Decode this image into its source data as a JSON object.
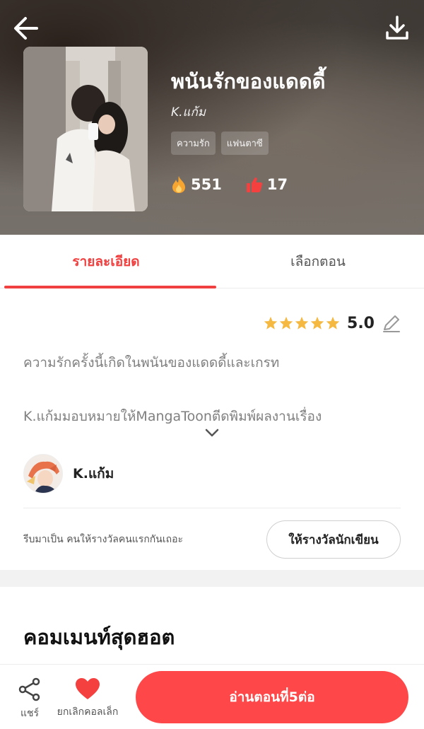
{
  "header": {
    "title": "พนันรักของแดดดี้",
    "author": "K.แก้ม",
    "tags": [
      "ความรัก",
      "แฟนตาซี"
    ],
    "stats": {
      "views": "551",
      "likes": "17"
    }
  },
  "tabs": [
    {
      "label": "รายละเอียด",
      "active": true
    },
    {
      "label": "เลือกตอน",
      "active": false
    }
  ],
  "rating": {
    "value": "5.0",
    "stars": 5
  },
  "description": {
    "line1": "ความรักครั้งนี้เกิดในพนันของแดดดี้และเกรท",
    "line2": "K.แก้มมอบหมายให้MangaToonตีดพิมพ์ผลงานเรื่อง"
  },
  "creator": {
    "name": "K.แก้ม"
  },
  "reward": {
    "text": "รีบมาเป็น คนให้รางวัลคนแรกกันเถอะ",
    "button_label": "ให้รางวัลนักเขียน"
  },
  "hot_comments": {
    "title": "คอมเมนท์สุดฮอต"
  },
  "bottom_bar": {
    "share_label": "แชร์",
    "unfavorite_label": "ยกเลิกคอลเล็ก",
    "read_button_label": "อ่านตอนที่5ต่อ"
  },
  "colors": {
    "accent": "#f04040",
    "read_button": "#fd4748",
    "star": "#f5b840"
  },
  "icons": [
    "back-arrow-icon",
    "download-icon",
    "fire-icon",
    "thumbs-up-icon",
    "star-icon",
    "edit-pencil-icon",
    "chevron-down-icon",
    "share-icon",
    "heart-icon"
  ]
}
